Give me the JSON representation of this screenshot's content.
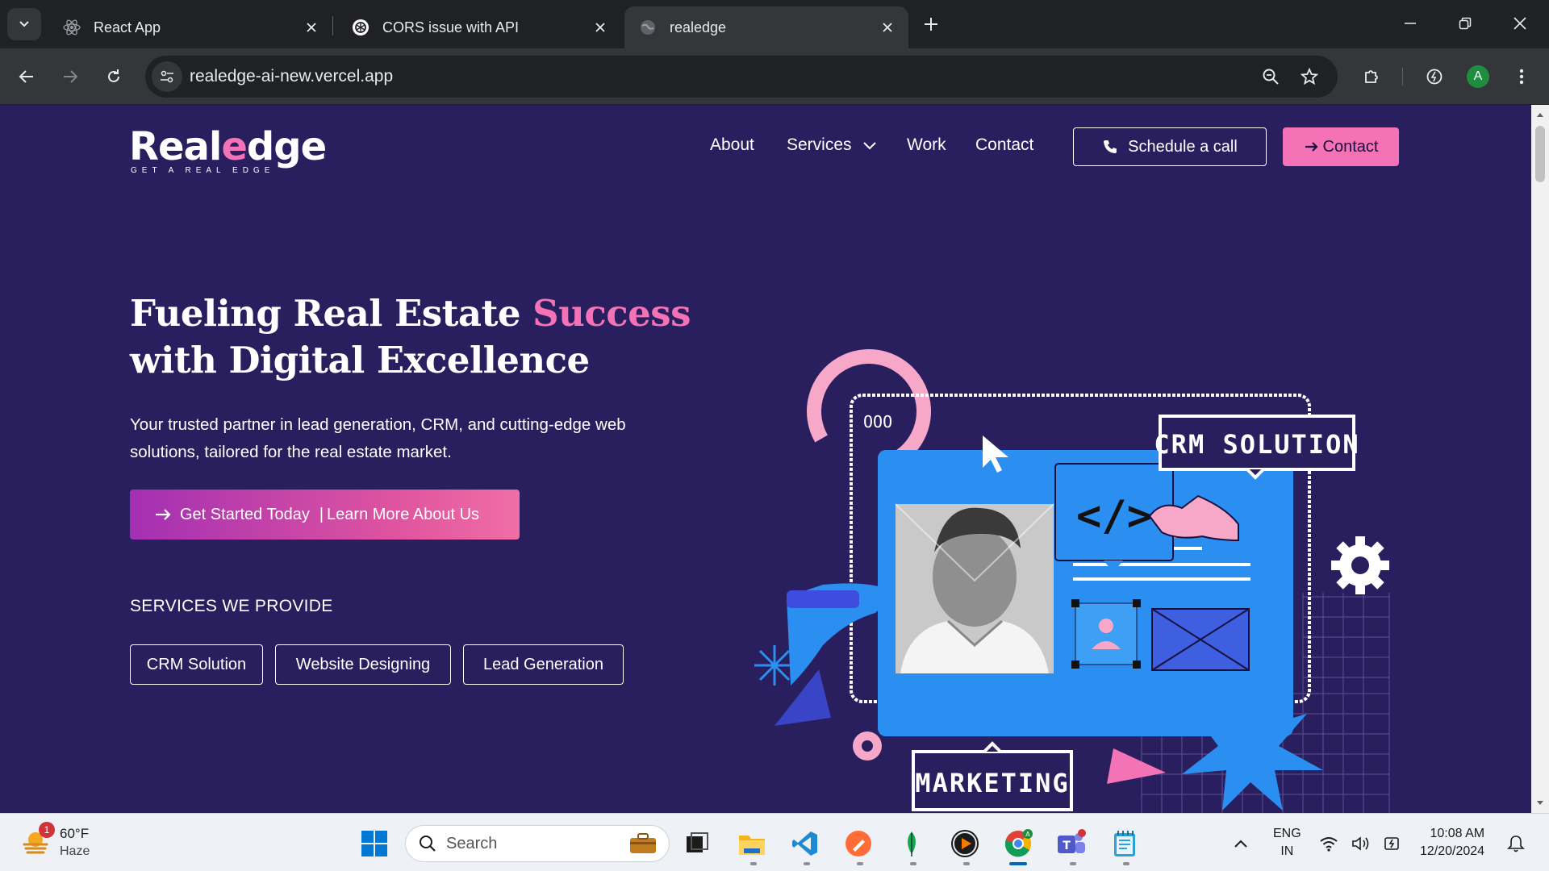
{
  "browser": {
    "tabs": [
      {
        "title": "React App",
        "active": false
      },
      {
        "title": "CORS issue with API",
        "active": false
      },
      {
        "title": "realedge",
        "active": true
      }
    ],
    "url": "realedge-ai-new.vercel.app"
  },
  "site": {
    "logo": {
      "pre": "Real",
      "mid": "e",
      "post": "dge",
      "tagline": "GET A REAL EDGE"
    },
    "nav": {
      "about": "About",
      "services": "Services",
      "work": "Work",
      "contact": "Contact",
      "schedule_btn": "Schedule a call",
      "contact_btn": "Contact"
    },
    "hero": {
      "headline_1": "Fueling Real Estate ",
      "headline_highlight": "Success",
      "headline_2": "with Digital Excellence",
      "subtext": "Your trusted partner in lead generation, CRM, and cutting-edge web solutions, tailored for the real estate market.",
      "cta_primary": "Get Started Today",
      "cta_separator": "|",
      "cta_secondary": "Learn More About Us"
    },
    "services_title": "SERVICES WE PROVIDE",
    "services": [
      "CRM Solution",
      "Website Designing",
      "Lead Generation"
    ],
    "illustration": {
      "crm_label": "CRM SOLUTION",
      "marketing_label": "MARKETING",
      "window_dots": "OOO",
      "code_glyph": "</>"
    },
    "colors": {
      "bg": "#2a1f5e",
      "accent_pink": "#f472b6",
      "accent_blue": "#2196f3"
    }
  },
  "taskbar": {
    "weather": {
      "temp": "60°F",
      "condition": "Haze",
      "badge": "1"
    },
    "search_placeholder": "Search",
    "language": {
      "lang": "ENG",
      "region": "IN"
    },
    "clock": {
      "time": "10:08 AM",
      "date": "12/20/2024"
    }
  }
}
